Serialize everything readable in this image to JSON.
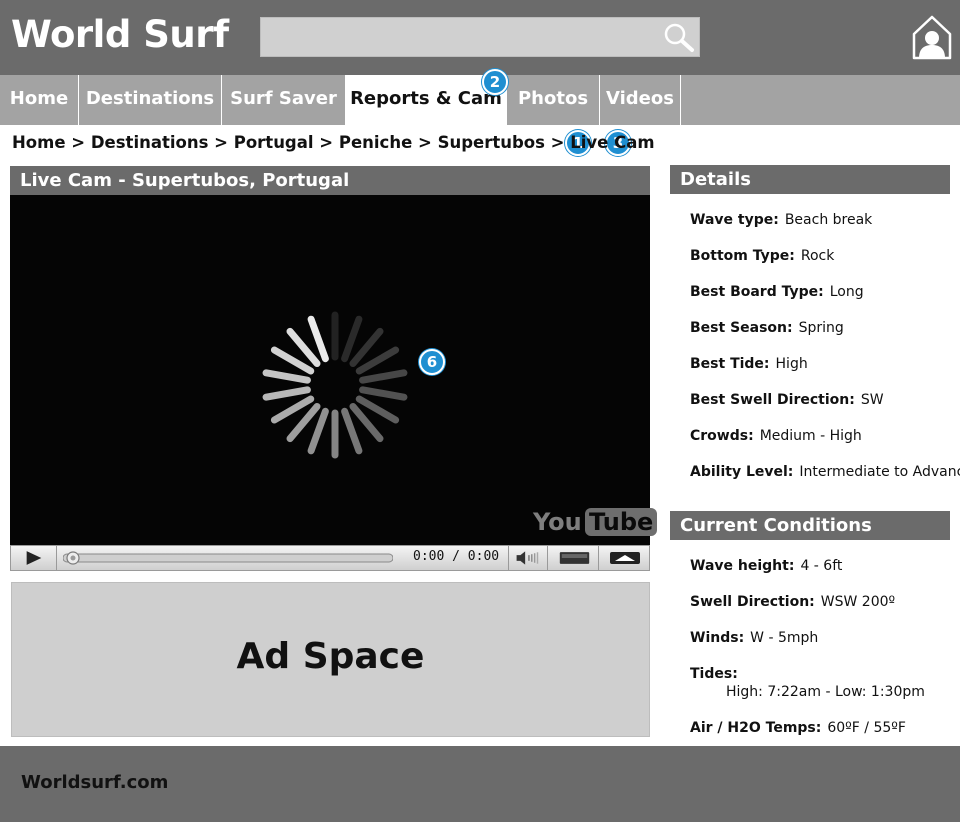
{
  "header": {
    "logo": "World Surf",
    "search": {
      "value": "",
      "placeholder": ""
    },
    "icons": [
      "search-icon",
      "account-icon"
    ]
  },
  "nav": {
    "tabs": [
      {
        "label": "Home",
        "active": false
      },
      {
        "label": "Destinations",
        "active": false
      },
      {
        "label": "Surf Saver",
        "active": false
      },
      {
        "label": "Reports & Cam",
        "active": true
      },
      {
        "label": "Photos",
        "active": false
      },
      {
        "label": "Videos",
        "active": false
      }
    ]
  },
  "badges": [
    "1",
    "2",
    "3",
    "6"
  ],
  "breadcrumb": "Home > Destinations > Portugal > Peniche > Supertubos > Live Cam",
  "video": {
    "title": "Live Cam - Supertubos, Portugal",
    "time": "0:00 / 0:00",
    "logo_you": "You",
    "logo_tube": "Tube"
  },
  "ad": {
    "label": "Ad Space"
  },
  "details": {
    "title": "Details",
    "items": [
      {
        "key": "Wave type:",
        "value": "Beach break"
      },
      {
        "key": "Bottom Type:",
        "value": "Rock"
      },
      {
        "key": "Best Board Type:",
        "value": "Long"
      },
      {
        "key": "Best Season:",
        "value": "Spring"
      },
      {
        "key": "Best Tide:",
        "value": "High"
      },
      {
        "key": "Best Swell Direction:",
        "value": "SW"
      },
      {
        "key": "Crowds:",
        "value": "Medium - High"
      },
      {
        "key": "Ability Level:",
        "value": "Intermediate to Advanced"
      }
    ]
  },
  "conditions": {
    "title": "Current Conditions",
    "items": [
      {
        "key": "Wave height:",
        "value": "4 - 6ft"
      },
      {
        "key": "Swell Direction:",
        "value": "WSW 200º"
      },
      {
        "key": "Winds:",
        "value": "W - 5mph"
      },
      {
        "key": "Tides:",
        "value": ""
      },
      {
        "key": "Air / H2O Temps:",
        "value": "60ºF / 55ºF"
      }
    ],
    "tides_detail": "High:  7:22am - Low:  1:30pm"
  },
  "footer": {
    "text": "Worldsurf.com"
  },
  "colors": {
    "header": "#6b6b6b",
    "nav": "#a3a3a3",
    "badge": "#1f8fd1"
  }
}
